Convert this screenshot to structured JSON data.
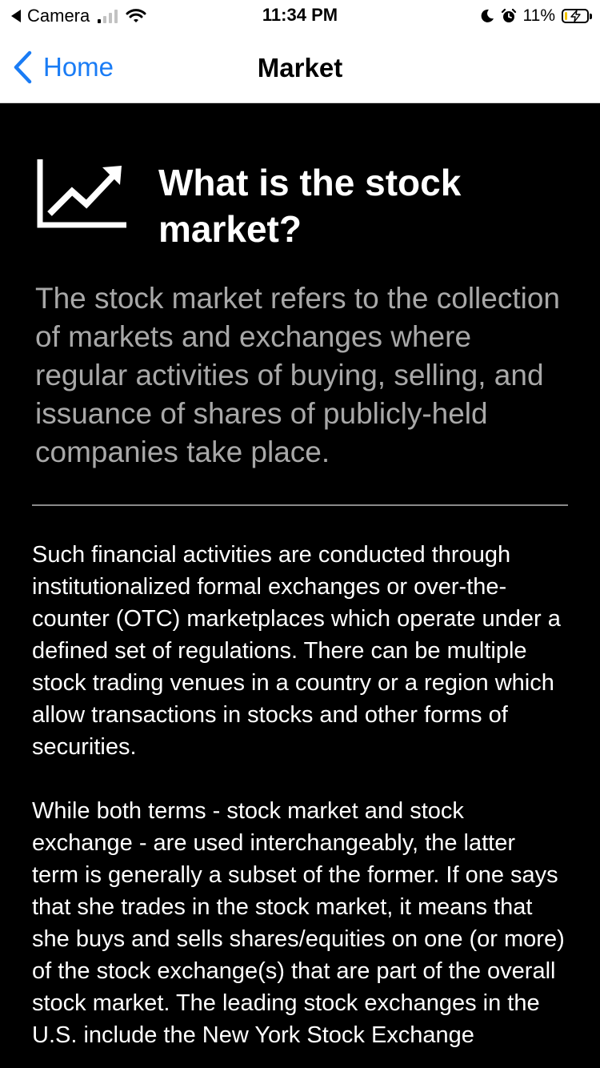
{
  "status_bar": {
    "back_app": "Camera",
    "time": "11:34 PM",
    "battery_percent": "11%",
    "signal_bars_filled": 1,
    "icons": [
      "back-arrow-icon",
      "signal-icon",
      "wifi-icon",
      "moon-icon",
      "alarm-icon",
      "battery-charging-icon"
    ]
  },
  "nav": {
    "back_label": "Home",
    "title": "Market",
    "accent_color": "#1a7cf5"
  },
  "article": {
    "icon": "trend-chart-icon",
    "heading": "What is the stock market?",
    "lead": "The stock market refers to the collection of markets and exchanges where regular activities of buying, selling, and issuance of shares of publicly-held companies take place.",
    "paragraphs": [
      "Such financial activities are conducted through institutionalized formal exchanges or over-the-counter (OTC) marketplaces which operate under a defined set of regulations. There can be multiple stock trading venues in a country or a region which allow transactions in stocks and other forms of securities.",
      "While both terms - stock market and stock exchange - are used interchangeably, the latter term is generally a subset of the former. If one says that she trades in the stock market, it means that she buys and sells shares/equities on one (or more) of the stock exchange(s) that are part of the overall stock market. The leading stock exchanges in the U.S. include the New York Stock Exchange"
    ]
  },
  "colors": {
    "content_background": "#000000",
    "heading_text": "#ffffff",
    "lead_text": "#a8a8a8",
    "body_text": "#ffffff"
  }
}
